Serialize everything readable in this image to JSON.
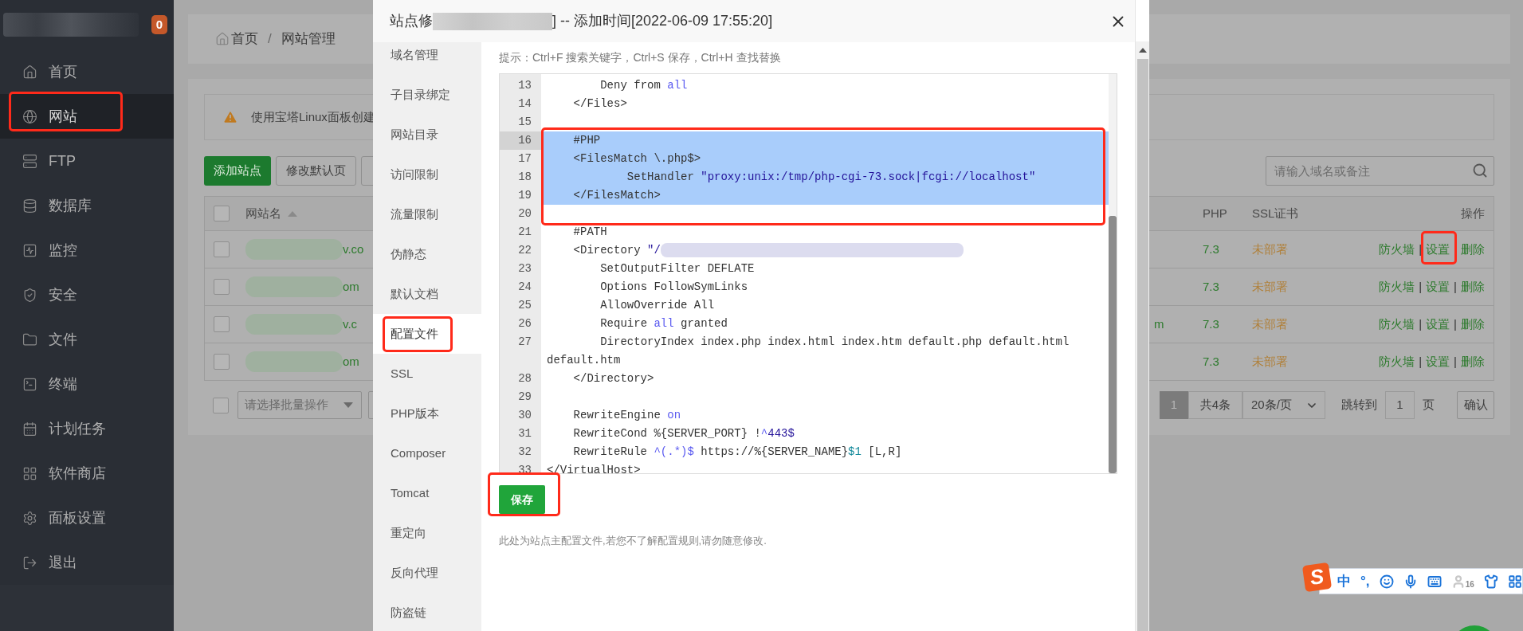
{
  "sidebar": {
    "badge": "0",
    "items": [
      {
        "label": "首页",
        "selected": false,
        "annotated": false
      },
      {
        "label": "网站",
        "selected": true,
        "annotated": true
      },
      {
        "label": "FTP",
        "selected": false,
        "annotated": false
      },
      {
        "label": "数据库",
        "selected": false,
        "annotated": false
      },
      {
        "label": "监控",
        "selected": false,
        "annotated": false
      },
      {
        "label": "安全",
        "selected": false,
        "annotated": false
      },
      {
        "label": "文件",
        "selected": false,
        "annotated": false
      },
      {
        "label": "终端",
        "selected": false,
        "annotated": false
      },
      {
        "label": "计划任务",
        "selected": false,
        "annotated": false
      },
      {
        "label": "软件商店",
        "selected": false,
        "annotated": false
      },
      {
        "label": "面板设置",
        "selected": false,
        "annotated": false
      },
      {
        "label": "退出",
        "selected": false,
        "annotated": false
      }
    ]
  },
  "breadcrumb": {
    "items": [
      "首页",
      "网站管理"
    ],
    "separator": "/"
  },
  "notice": {
    "text": "使用宝塔Linux面板创建"
  },
  "toolbar": {
    "buttons": [
      {
        "label": "添加站点",
        "kind": "primary"
      },
      {
        "label": "修改默认页",
        "kind": "default"
      }
    ]
  },
  "search": {
    "placeholder": "请输入域名或备注"
  },
  "table": {
    "header_checked": false,
    "name_column": "网站名",
    "columns": [
      "PHP",
      "SSL证书",
      "操作"
    ],
    "action_separator": "|",
    "rows": [
      {
        "checked": false,
        "name": "v.co",
        "php": "7.3",
        "ssl": "未部署",
        "actions": [
          {
            "label": "防火墙",
            "annotated": false
          },
          {
            "label": "设置",
            "annotated": true
          },
          {
            "label": "删除",
            "annotated": false
          }
        ]
      },
      {
        "checked": false,
        "name": "om",
        "php": "7.3",
        "ssl": "未部署",
        "actions": [
          {
            "label": "防火墙",
            "annotated": false
          },
          {
            "label": "设置",
            "annotated": false
          },
          {
            "label": "删除",
            "annotated": false
          }
        ]
      },
      {
        "checked": false,
        "name": "v.c",
        "column_2": "m",
        "php": "7.3",
        "ssl": "未部署",
        "actions": [
          {
            "label": "防火墙",
            "annotated": false
          },
          {
            "label": "设置",
            "annotated": false
          },
          {
            "label": "删除",
            "annotated": false
          }
        ]
      },
      {
        "checked": false,
        "name": "om",
        "php": "7.3",
        "ssl": "未部署",
        "actions": [
          {
            "label": "防火墙",
            "annotated": false
          },
          {
            "label": "设置",
            "annotated": false
          },
          {
            "label": "删除",
            "annotated": false
          }
        ]
      }
    ]
  },
  "footer": {
    "select_all_checked": false,
    "batch_placeholder": "请选择批量操作",
    "pages": [
      {
        "label": "1",
        "selected": true
      }
    ],
    "total": "共4条",
    "per_page": "20条/页",
    "jump_label": "跳转到",
    "jump_value": "1",
    "page_suffix": "页",
    "confirm": "确认"
  },
  "dialog": {
    "title_start": "站点修",
    "title_end": "] -- 添加时间[2022-06-09 17:55:20]",
    "nav": [
      {
        "label": "域名管理",
        "selected": false,
        "annotated": false
      },
      {
        "label": "子目录绑定",
        "selected": false,
        "annotated": false
      },
      {
        "label": "网站目录",
        "selected": false,
        "annotated": false
      },
      {
        "label": "访问限制",
        "selected": false,
        "annotated": false
      },
      {
        "label": "流量限制",
        "selected": false,
        "annotated": false
      },
      {
        "label": "伪静态",
        "selected": false,
        "annotated": false
      },
      {
        "label": "默认文档",
        "selected": false,
        "annotated": false
      },
      {
        "label": "配置文件",
        "selected": true,
        "annotated": true
      },
      {
        "label": "SSL",
        "selected": false,
        "annotated": false
      },
      {
        "label": "PHP版本",
        "selected": false,
        "annotated": false
      },
      {
        "label": "Composer",
        "selected": false,
        "annotated": false
      },
      {
        "label": "Tomcat",
        "selected": false,
        "annotated": false
      },
      {
        "label": "重定向",
        "selected": false,
        "annotated": false
      },
      {
        "label": "反向代理",
        "selected": false,
        "annotated": false
      },
      {
        "label": "防盗链",
        "selected": false,
        "annotated": false
      }
    ],
    "tip": "提示：Ctrl+F 搜索关键字，Ctrl+S 保存，Ctrl+H 查找替换",
    "blocks": [
      {
        "annotated": false,
        "lines": [
          {
            "number": "13",
            "selected": false,
            "active": false,
            "segments": [
              {
                "kind": "plain",
                "text": "        Deny from "
              },
              {
                "kind": "keyword",
                "text": "all"
              }
            ]
          },
          {
            "number": "14",
            "selected": false,
            "active": false,
            "segments": [
              {
                "kind": "plain",
                "text": "    </Files>"
              }
            ]
          },
          {
            "number": "15",
            "selected": false,
            "active": false
          }
        ]
      },
      {
        "annotated": true,
        "lines": [
          {
            "number": "16",
            "selected": true,
            "active": true,
            "segments": [
              {
                "kind": "plain",
                "text": "    #PHP"
              }
            ]
          },
          {
            "number": "17",
            "selected": true,
            "active": false,
            "segments": [
              {
                "kind": "plain",
                "text": "    <FilesMatch \\.php$>"
              }
            ]
          },
          {
            "number": "18",
            "selected": true,
            "active": false,
            "segments": [
              {
                "kind": "plain",
                "text": "            SetHandler "
              },
              {
                "kind": "string",
                "text": "\"proxy:unix:/tmp/php-cgi-73.sock|fcgi://localhost\""
              }
            ]
          },
          {
            "number": "19",
            "selected": true,
            "active": false,
            "segments": [
              {
                "kind": "plain",
                "text": "    </FilesMatch>"
              }
            ]
          },
          {
            "number": "20",
            "selected": false,
            "active": false
          }
        ]
      },
      {
        "annotated": false,
        "lines": [
          {
            "number": "21",
            "selected": false,
            "active": false,
            "segments": [
              {
                "kind": "plain",
                "text": "    #PATH"
              }
            ]
          },
          {
            "number": "22",
            "selected": false,
            "active": false,
            "segments": [
              {
                "kind": "plain",
                "text": "    <Directory "
              },
              {
                "kind": "string",
                "text": "\"/"
              },
              {
                "kind": "redaction"
              }
            ]
          },
          {
            "number": "23",
            "selected": false,
            "active": false,
            "segments": [
              {
                "kind": "plain",
                "text": "        SetOutputFilter DEFLATE"
              }
            ]
          },
          {
            "number": "24",
            "selected": false,
            "active": false,
            "segments": [
              {
                "kind": "plain",
                "text": "        Options FollowSymLinks"
              }
            ]
          },
          {
            "number": "25",
            "selected": false,
            "active": false,
            "segments": [
              {
                "kind": "plain",
                "text": "        AllowOverride All"
              }
            ]
          },
          {
            "number": "26",
            "selected": false,
            "active": false,
            "segments": [
              {
                "kind": "plain",
                "text": "        Require "
              },
              {
                "kind": "keyword",
                "text": "all"
              },
              {
                "kind": "plain",
                "text": " granted"
              }
            ]
          },
          {
            "number": "27",
            "selected": false,
            "active": false,
            "segments": [
              {
                "kind": "plain",
                "text": "        DirectoryIndex index.php index.html index.htm default.php default.html default.htm"
              }
            ]
          },
          {
            "number": "28",
            "selected": false,
            "active": false,
            "segments": [
              {
                "kind": "plain",
                "text": "    </Directory>"
              }
            ]
          },
          {
            "number": "29",
            "selected": false,
            "active": false
          },
          {
            "number": "30",
            "selected": false,
            "active": false,
            "segments": [
              {
                "kind": "plain",
                "text": "    RewriteEngine "
              },
              {
                "kind": "keyword",
                "text": "on"
              }
            ]
          },
          {
            "number": "31",
            "selected": false,
            "active": false,
            "segments": [
              {
                "kind": "plain",
                "text": "    RewriteCond %{SERVER_PORT} !"
              },
              {
                "kind": "keyword",
                "text": "^"
              },
              {
                "kind": "string",
                "text": "443$"
              }
            ]
          },
          {
            "number": "32",
            "selected": false,
            "active": false,
            "segments": [
              {
                "kind": "plain",
                "text": "    RewriteRule "
              },
              {
                "kind": "keyword",
                "text": "^(.*)$"
              },
              {
                "kind": "plain",
                "text": " https://%{SERVER_NAME}"
              },
              {
                "kind": "variable",
                "text": "$1"
              },
              {
                "kind": "plain",
                "text": " [L,R]"
              }
            ]
          },
          {
            "number": "33",
            "selected": false,
            "active": false,
            "segments": [
              {
                "kind": "plain",
                "text": "</VirtualHost>"
              }
            ]
          }
        ]
      }
    ],
    "save": {
      "label": "保存",
      "annotated": true
    },
    "note": "此处为站点主配置文件,若您不了解配置规则,请勿随意修改."
  },
  "ime": {
    "logo": "S",
    "mode": "中",
    "punctuation": "°,",
    "skin_badge": "16"
  }
}
